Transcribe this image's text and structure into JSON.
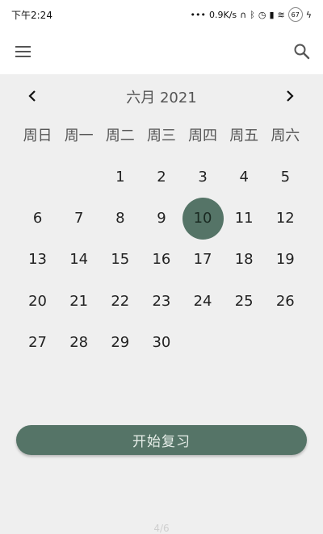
{
  "status": {
    "time": "下午2:24",
    "net_speed": "0.9K/s",
    "battery": "67"
  },
  "calendar": {
    "month_title": "六月 2021",
    "weekdays": [
      "周日",
      "周一",
      "周二",
      "周三",
      "周四",
      "周五",
      "周六"
    ],
    "leading_empty": 2,
    "days": [
      "1",
      "2",
      "3",
      "4",
      "5",
      "6",
      "7",
      "8",
      "9",
      "10",
      "11",
      "12",
      "13",
      "14",
      "15",
      "16",
      "17",
      "18",
      "19",
      "20",
      "21",
      "22",
      "23",
      "24",
      "25",
      "26",
      "27",
      "28",
      "29",
      "30"
    ],
    "selected_day": "10"
  },
  "actions": {
    "start_review": "开始复习"
  },
  "pager": {
    "label": "4/6"
  },
  "colors": {
    "accent": "#557467",
    "background": "#efefef"
  },
  "icons": {
    "menu": "menu-icon",
    "search": "search-icon",
    "prev": "chevron-left-icon",
    "next": "chevron-right-icon"
  }
}
